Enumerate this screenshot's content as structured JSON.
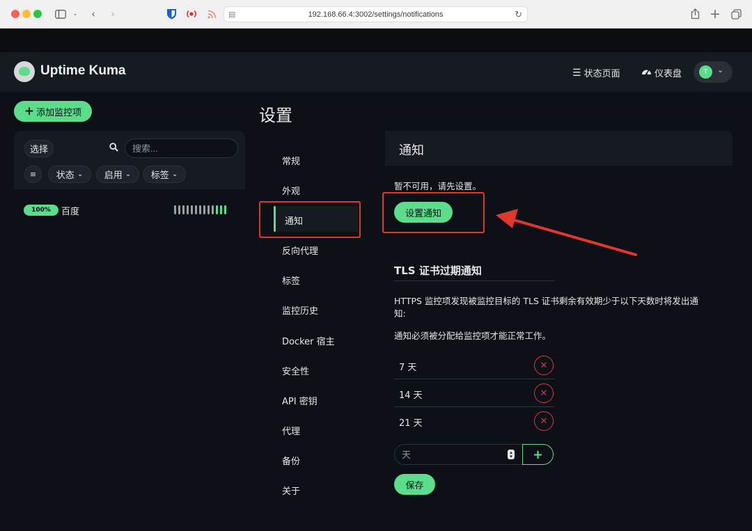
{
  "browser": {
    "url": "192.168.66.4:3002/settings/notifications"
  },
  "header": {
    "brand": "Uptime Kuma",
    "status_pages_label": "状态页面",
    "dashboard_label": "仪表盘",
    "avatar_initial": "T"
  },
  "sidebar": {
    "add_monitor_label": "添加监控项",
    "select_label": "选择",
    "search_placeholder": "搜索...",
    "filters": {
      "status": "状态",
      "active": "启用",
      "tags": "标签"
    },
    "monitors": [
      {
        "uptime": "100%",
        "name": "百度"
      }
    ]
  },
  "settings": {
    "title": "设置",
    "menu": [
      {
        "label": "常规"
      },
      {
        "label": "外观"
      },
      {
        "label": "通知"
      },
      {
        "label": "反向代理"
      },
      {
        "label": "标签"
      },
      {
        "label": "监控历史"
      },
      {
        "label": "Docker 宿主"
      },
      {
        "label": "安全性"
      },
      {
        "label": "API 密钥"
      },
      {
        "label": "代理"
      },
      {
        "label": "备份"
      },
      {
        "label": "关于"
      }
    ],
    "active_item": "通知",
    "content": {
      "title": "通知",
      "unavailable_text": "暂不可用，请先设置。",
      "setup_button": "设置通知",
      "tls_title": "TLS 证书过期通知",
      "tls_desc": "HTTPS 监控项发现被监控目标的 TLS 证书剩余有效期少于以下天数时将发出通知:",
      "tls_note": "通知必须被分配给监控项才能正常工作。",
      "days": [
        "7 天",
        "14 天",
        "21 天"
      ],
      "day_input_placeholder": "天",
      "save_button": "保存"
    }
  },
  "colors": {
    "accent": "#5cdd8b",
    "danger": "#dc3545",
    "annotation": "#e1382e"
  }
}
